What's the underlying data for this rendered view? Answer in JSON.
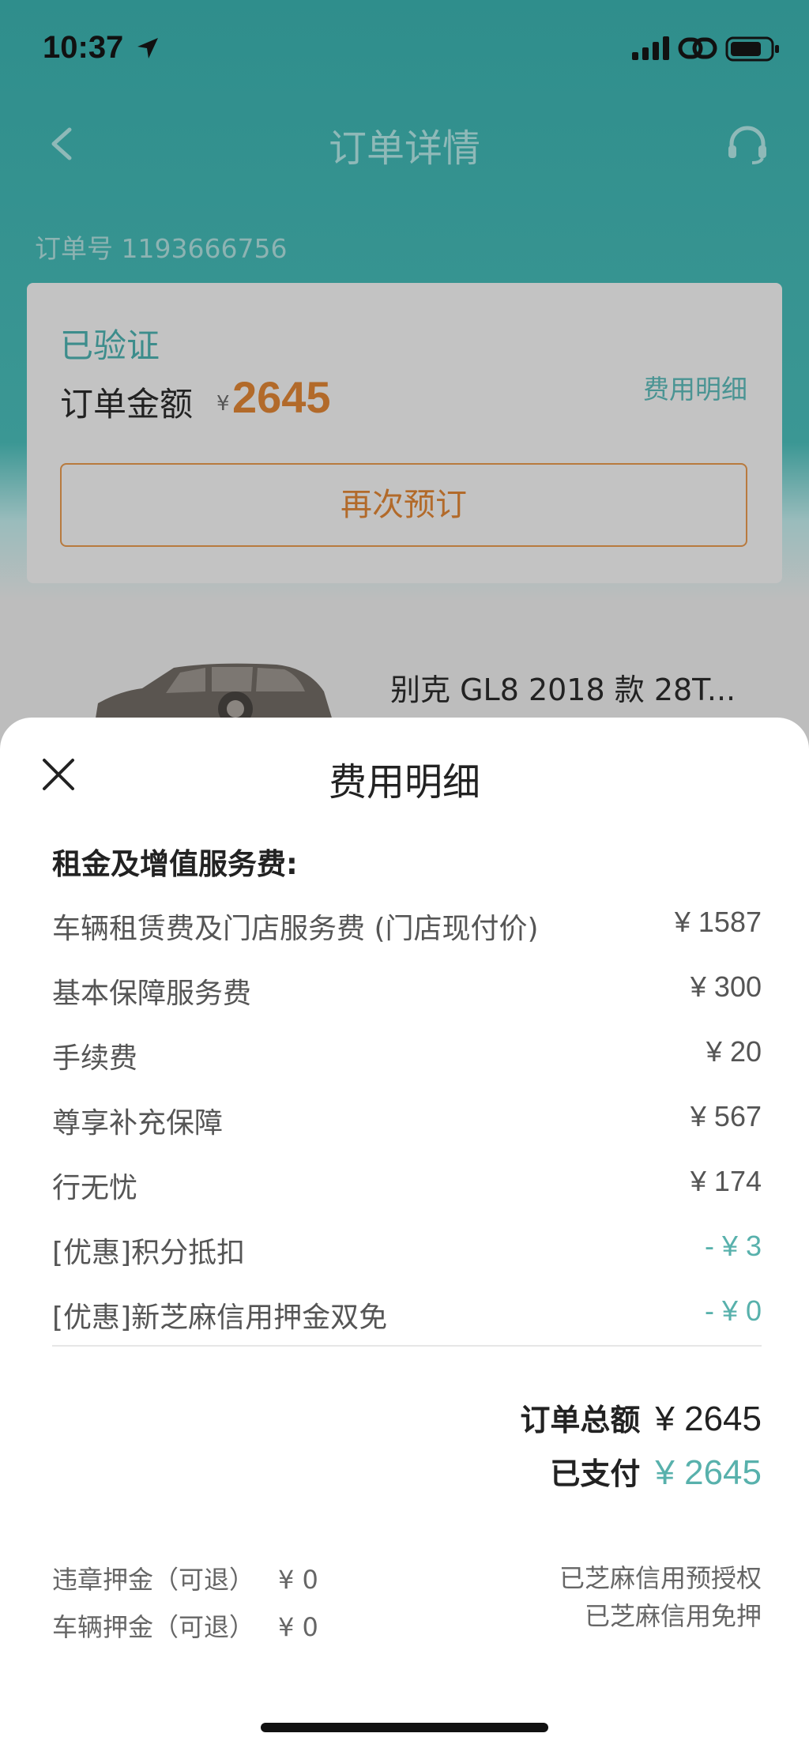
{
  "status_bar": {
    "time": "10:37"
  },
  "nav": {
    "title": "订单详情"
  },
  "order": {
    "order_no": "订单号 1193666756",
    "status": "已验证",
    "amount_label": "订单金额",
    "currency": "¥",
    "amount": "2645",
    "fee_detail_link": "费用明细",
    "rebook_label": "再次预订"
  },
  "car": {
    "title": "别克 GL8 2018 款 28T..."
  },
  "sheet": {
    "title": "费用明细",
    "section_title": "租金及增值服务费:",
    "fees": [
      {
        "name": "车辆租赁费及门店服务费 (门店现付价)",
        "amount": "¥ 1587"
      },
      {
        "name": "基本保障服务费",
        "amount": "¥ 300"
      },
      {
        "name": "手续费",
        "amount": "¥ 20"
      },
      {
        "name": "尊享补充保障",
        "amount": "¥ 567"
      },
      {
        "name": "行无忧",
        "amount": "¥ 174"
      },
      {
        "name": "[优惠]积分抵扣",
        "amount": "- ¥ 3"
      },
      {
        "name": "[优惠]新芝麻信用押金双免",
        "amount": "- ¥ 0"
      }
    ],
    "total_label": "订单总额",
    "total_value": "¥ 2645",
    "paid_label": "已支付",
    "paid_value": "¥ 2645",
    "deposits": [
      {
        "label": "违章押金（可退）",
        "value": "¥ 0"
      },
      {
        "label": "车辆押金（可退）",
        "value": "¥ 0"
      }
    ],
    "preauth": [
      "已芝麻信用预授权",
      "已芝麻信用免押"
    ]
  },
  "colors": {
    "accent_teal": "#58b1ac",
    "accent_orange": "#b26a2a",
    "header_teal": "#3b9794"
  }
}
